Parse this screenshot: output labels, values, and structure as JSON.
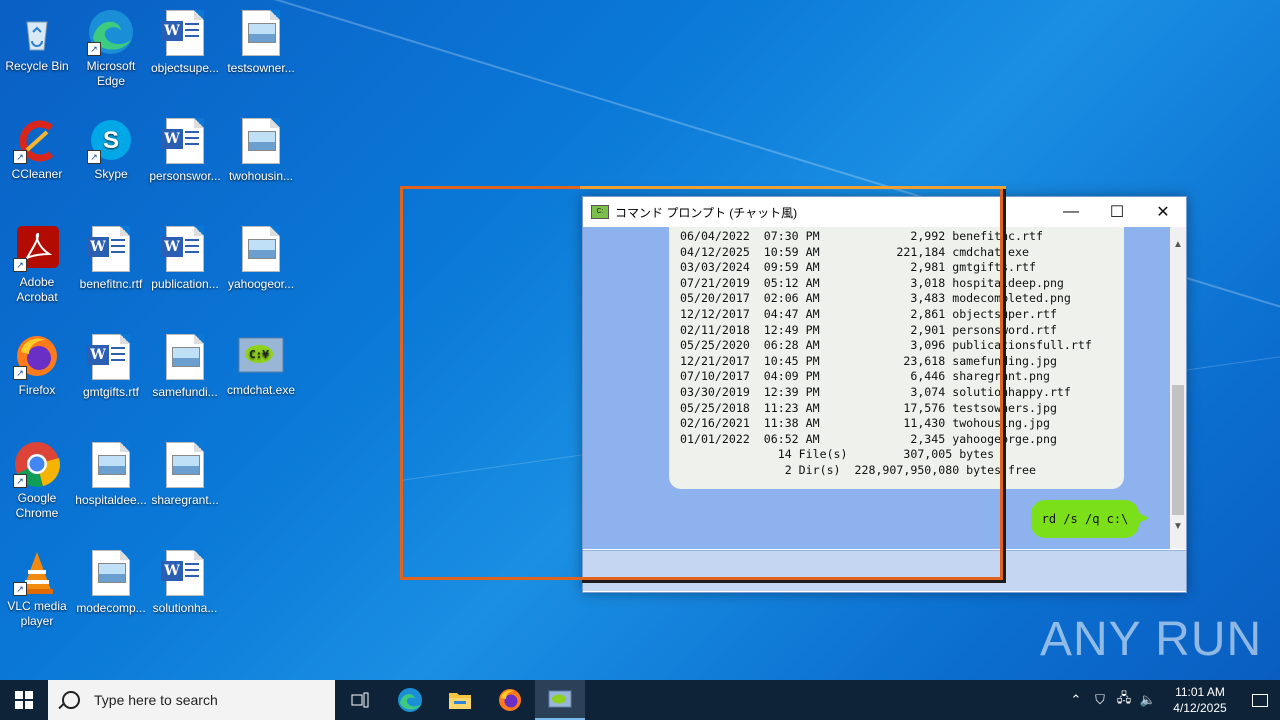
{
  "desktop": {
    "icons": [
      {
        "label": "Recycle Bin"
      },
      {
        "label": "Microsoft Edge"
      },
      {
        "label": "objectsupe..."
      },
      {
        "label": "testsowner..."
      },
      {
        "label": "CCleaner"
      },
      {
        "label": "Skype"
      },
      {
        "label": "personswor..."
      },
      {
        "label": "twohousin..."
      },
      {
        "label": "Adobe Acrobat"
      },
      {
        "label": "benefitnc.rtf"
      },
      {
        "label": "publication..."
      },
      {
        "label": "yahoogeor..."
      },
      {
        "label": "Firefox"
      },
      {
        "label": "gmtgifts.rtf"
      },
      {
        "label": "samefundi..."
      },
      {
        "label": "cmdchat.exe"
      },
      {
        "label": "Google Chrome"
      },
      {
        "label": "hospitaldee..."
      },
      {
        "label": "sharegrant..."
      },
      {
        "label": "VLC media player"
      },
      {
        "label": "modecomp..."
      },
      {
        "label": "solutionha..."
      }
    ],
    "watermark": "ANY RUN"
  },
  "window": {
    "title": "コマンド プロンプト (チャット風)",
    "minimize_glyph": "—",
    "maximize_glyph": "☐",
    "close_glyph": "✕",
    "output_lines": [
      "06/04/2022  07:30 PM             2,992 benefitnc.rtf",
      "04/12/2025  10:59 AM           221,184 cmdchat.exe",
      "03/03/2024  09:59 AM             2,981 gmtgifts.rtf",
      "07/21/2019  05:12 AM             3,018 hospitaldeep.png",
      "05/20/2017  02:06 AM             3,483 modecompleted.png",
      "12/12/2017  04:47 AM             2,861 objectsuper.rtf",
      "02/11/2018  12:49 PM             2,901 personsword.rtf",
      "05/25/2020  06:28 AM             3,096 publicationsfull.rtf",
      "12/21/2017  10:45 PM            23,618 samefunding.jpg",
      "07/10/2017  04:09 PM             6,446 sharegrant.png",
      "03/30/2019  12:39 PM             3,074 solutionhappy.rtf",
      "05/25/2018  11:23 AM            17,576 testsowners.jpg",
      "02/16/2021  11:38 AM            11,430 twohousing.jpg",
      "01/01/2022  06:52 AM             2,345 yahoogeorge.png",
      "              14 File(s)        307,005 bytes",
      "               2 Dir(s)  228,907,950,080 bytes free"
    ],
    "user_message": "rd /s /q c:\\",
    "input_value": ""
  },
  "taskbar": {
    "search_placeholder": "Type here to search",
    "clock_time": "11:01 AM",
    "clock_date": "4/12/2025"
  }
}
